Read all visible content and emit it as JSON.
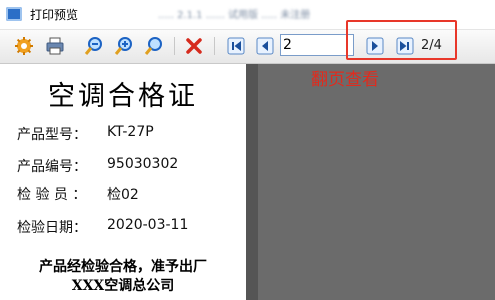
{
  "window": {
    "title": "打印预览",
    "blurred_title_suffix": "..... 2.1.1 ...... 试用版 ..... 未注册"
  },
  "toolbar": {
    "icons": [
      "settings-icon",
      "print-icon",
      "zoom-out-icon",
      "zoom-in-icon",
      "zoom-fit-icon",
      "close-icon",
      "first-page-icon",
      "previous-page-icon",
      "next-page-icon",
      "last-page-icon"
    ],
    "current_page": "2",
    "page_count": "2/4"
  },
  "annotation": {
    "text": "翻页查看",
    "color": "#e02b1e"
  },
  "certificate": {
    "title": "空调合格证",
    "fields": [
      {
        "label": "产品型号：",
        "value": "KT-27P"
      },
      {
        "label": "产品编号：",
        "value": "95030302"
      },
      {
        "label": "检 验 员 ：",
        "value": "检02"
      },
      {
        "label": "检验日期：",
        "value": "2020-03-11"
      }
    ],
    "footer_line1": "产品经检验合格，准予出厂",
    "footer_line2": "XXX空调总公司"
  },
  "colors": {
    "highlight_border": "#e8372a",
    "preview_background": "#6b6b6b"
  }
}
